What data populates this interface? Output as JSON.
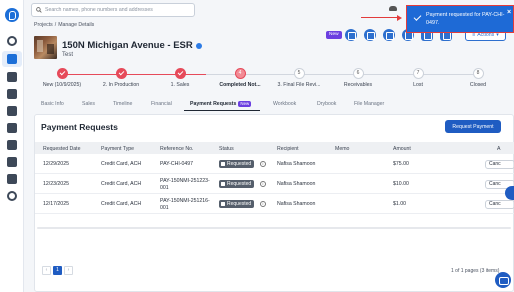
{
  "search": {
    "placeholder": "Search names, phone numbers and addresses"
  },
  "breadcrumb": [
    "Projects",
    "/",
    "Manage Details"
  ],
  "project": {
    "title": "150N Michigan Avenue - ESR",
    "subtitle": "Test"
  },
  "header": {
    "new_badge": "New",
    "actions_label": "Actions"
  },
  "toast": {
    "message": "Payment requested for PAY-CHI-0497.",
    "close": "×"
  },
  "stages": [
    {
      "label": "New (10/9/2025)",
      "state": "done",
      "num": ""
    },
    {
      "label": "2. In Production",
      "state": "done",
      "num": ""
    },
    {
      "label": "1. Sales",
      "state": "done",
      "num": ""
    },
    {
      "label": "Completed Not...",
      "state": "current",
      "num": "4"
    },
    {
      "label": "3. Final File Revi...",
      "state": "todo",
      "num": "5"
    },
    {
      "label": "Receivables",
      "state": "todo",
      "num": "6"
    },
    {
      "label": "Lost",
      "state": "todo",
      "num": "7"
    },
    {
      "label": "Closed",
      "state": "todo",
      "num": "8"
    }
  ],
  "tabs": [
    "Basic Info",
    "Sales",
    "Timeline",
    "Financial",
    "Payment Requests",
    "Workbook",
    "Drybook",
    "File Manager"
  ],
  "tab_new_badge": "New",
  "card": {
    "title": "Payment Requests",
    "button": "Request Payment"
  },
  "table": {
    "headers": [
      "Requested Date",
      "Payment Type",
      "Reference No.",
      "Status",
      "Recipient",
      "Memo",
      "Amount",
      "A"
    ],
    "rows": [
      {
        "date": "12/29/2025",
        "type": "Credit Card, ACH",
        "ref1": "PAY-CHI-0497",
        "ref2": "",
        "status": "Requested",
        "recipient": "Nafisa Shamoon",
        "memo": "",
        "amount": "$75.00",
        "action": "Canc"
      },
      {
        "date": "12/23/2025",
        "type": "Credit Card, ACH",
        "ref1": "PAY-150NMI-251223-",
        "ref2": "001",
        "status": "Requested",
        "recipient": "Nafisa Shamoon",
        "memo": "",
        "amount": "$10.00",
        "action": "Canc"
      },
      {
        "date": "12/17/2025",
        "type": "Credit Card, ACH",
        "ref1": "PAY-150NMI-251216-",
        "ref2": "001",
        "status": "Requested",
        "recipient": "Nafisa Shamoon",
        "memo": "",
        "amount": "$1.00",
        "action": "Canc"
      }
    ]
  },
  "pagination": {
    "prev": "‹",
    "current": "1",
    "next": "›",
    "info": "1 of 1 pages (3 items)"
  },
  "colors": {
    "primary": "#1f5cc2",
    "accent_red": "#e64a5a",
    "new_badge": "#6b3fe0",
    "toast_bg": "#1e6ad6",
    "toast_border": "#e23b3b"
  }
}
